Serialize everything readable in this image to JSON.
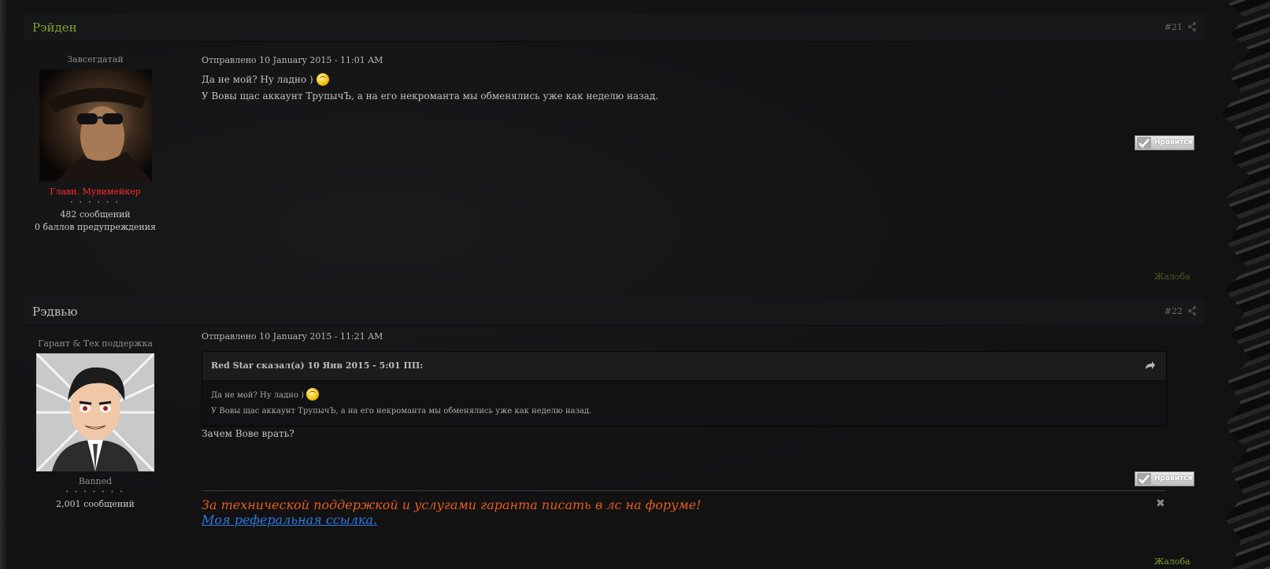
{
  "colors": {
    "green_name": "#7fa22d",
    "red_group": "#ff2a2a",
    "grey_text": "#8d8d8d",
    "report_dim": "#4f5a1f",
    "report_green": "#7fa22d"
  },
  "posts": [
    {
      "author": "Рэйден",
      "number": "#21",
      "user_title": "Завсегдатай",
      "group": "Главн. Мувимейкер",
      "pips": "• • • • • •",
      "message_count": "482 сообщений",
      "warnings": "0 баллов предупреждения",
      "posted": "Отправлено 10 January 2015 - 11:01 AM",
      "lines": [
        "Да не мой? Ну ладно )",
        "У Вовы щас аккаунт ТрупычЪ, а на его  некроманта мы обменялись уже как неделю назад."
      ],
      "like_label": "Нравится",
      "report_label": "Жалоба"
    },
    {
      "author": "Рэдвью",
      "number": "#22",
      "user_title": "Гарант & Тех поддержка",
      "group": "Banned",
      "pips": "• • • • • • •",
      "message_count": "2,001 сообщений",
      "posted": "Отправлено 10 January 2015 - 11:21 AM",
      "quote": {
        "cite": "Red Star сказал(а) 10 Янв 2015 - 5:01 ПП:",
        "lines": [
          "Да не мой? Ну ладно )",
          "У Вовы щас аккаунт ТрупычЪ, а на его  некроманта мы обменялись уже как неделю назад."
        ]
      },
      "reply": "Зачем Вове врать?",
      "like_label": "Нравится",
      "signature": "За технической поддержкой и услугами гаранта писать в лс на форуме!",
      "signature_link": "Моя реферальная ссылка.",
      "report_label": "Жалоба"
    }
  ]
}
